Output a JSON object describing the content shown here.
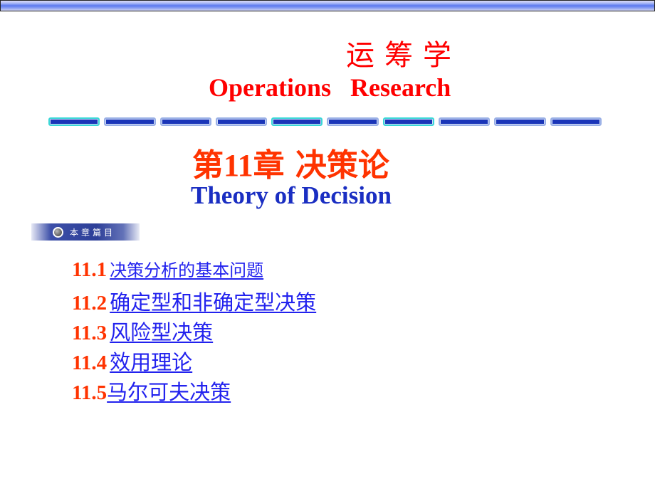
{
  "header": {
    "title_cn": "运筹学",
    "title_en": "Operations   Research"
  },
  "chapter": {
    "prefix": "第",
    "number": "11",
    "suffix": "章 决策论",
    "subtitle": "Theory of Decision"
  },
  "contents_badge": {
    "label": "本章篇目"
  },
  "toc": [
    {
      "number": "11.1",
      "title": "决策分析的基本问题"
    },
    {
      "number": "11.2",
      "title": "确定型和非确定型决策"
    },
    {
      "number": "11.3",
      "title": "风险型决策"
    },
    {
      "number": "11.4",
      "title": "效用理论"
    },
    {
      "number": "11.5",
      "title": "马尔可夫决策"
    }
  ],
  "colors": {
    "title_red": "#ff0000",
    "chapter_orange_red": "#ff3300",
    "subtitle_blue": "#1a2ec2",
    "link_blue": "#2222ee"
  }
}
